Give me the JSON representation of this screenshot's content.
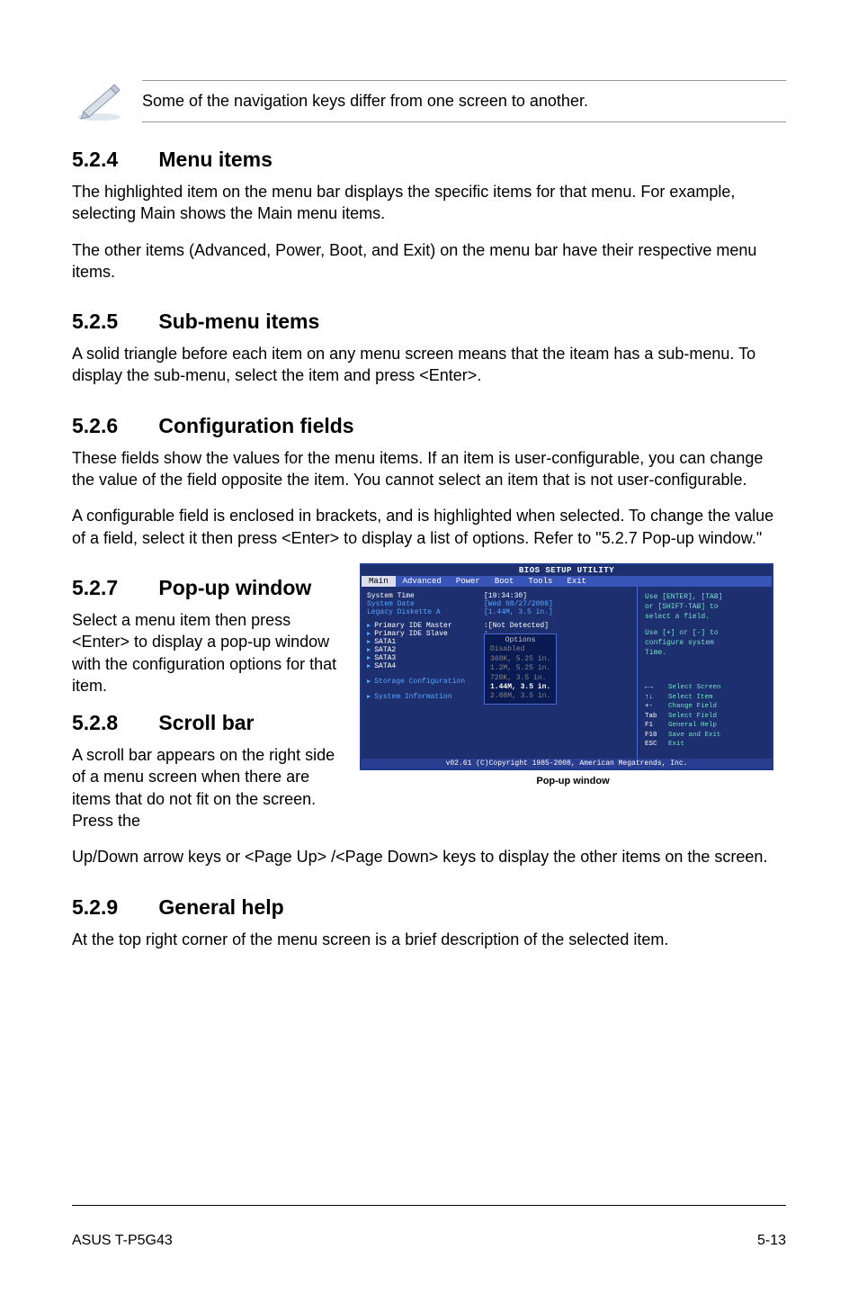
{
  "note": {
    "text": "Some of the navigation keys differ from one screen to another."
  },
  "s524": {
    "num": "5.2.4",
    "title": "Menu items",
    "p1": "The highlighted item on the menu bar  displays the specific items for that menu. For example, selecting Main shows the Main menu items.",
    "p2": "The other items (Advanced, Power, Boot, and Exit) on the menu bar have their respective menu items."
  },
  "s525": {
    "num": "5.2.5",
    "title": "Sub-menu items",
    "p1": "A solid triangle before each item on any menu screen means that the iteam has a sub-menu. To display the sub-menu, select the item and press <Enter>."
  },
  "s526": {
    "num": "5.2.6",
    "title": "Configuration fields",
    "p1": "These fields show the values for the menu items. If an item is user-configurable, you can change the value of the field opposite the item. You cannot select an item that is not user-configurable.",
    "p2": "A configurable field is enclosed in brackets, and is highlighted when selected. To change the value of a field, select it then press <Enter> to display a list of options. Refer to \"5.2.7 Pop-up window.\""
  },
  "s527": {
    "num": "5.2.7",
    "title": "Pop-up window",
    "p1": "Select a menu item then press <Enter> to display a pop-up window with the configuration options for that item."
  },
  "s528": {
    "num": "5.2.8",
    "title": "Scroll bar",
    "p1a": "A scroll bar appears on the right side of a menu screen when there are items that do not fit on the screen. Press the",
    "p1b": "Up/Down arrow keys or <Page Up> /<Page Down> keys to display the other items on the screen."
  },
  "s529": {
    "num": "5.2.9",
    "title": "General help",
    "p1": "At the top right corner of the menu screen is a brief description of the selected item."
  },
  "bios": {
    "title": "BIOS SETUP UTILITY",
    "menu": [
      "Main",
      "Advanced",
      "Power",
      "Boot",
      "Tools",
      "Exit"
    ],
    "rows": {
      "system_time_lbl": "System Time",
      "system_time_val": "[19:34:30]",
      "system_date_lbl": "System Date",
      "system_date_val": "[Wed 08/27/2008]",
      "legacy_lbl": "Legacy Diskette A",
      "legacy_val": "[1.44M, 3.5 in.]",
      "pri_master_lbl": "Primary IDE Master",
      "pri_master_val": ":[Not Detected]",
      "pri_slave_lbl": "Primary IDE Slave",
      "pri_slave_val": ":",
      "sata1_lbl": "SATA1",
      "sata1_val": ":",
      "sata2_lbl": "SATA2",
      "sata2_val": ":",
      "sata3_lbl": "SATA3",
      "sata3_val": ":",
      "sata4_lbl": "SATA4",
      "sata4_val": ":",
      "storage_lbl": "Storage Configuration",
      "sysinfo_lbl": "System Information"
    },
    "popup": {
      "header": "Options",
      "opt1": "Disabled",
      "opt2": "360K, 5.25 in.",
      "opt3": "1.2M, 5.25 in.",
      "opt4": "720K, 3.5 in.",
      "opt5": "1.44M, 3.5 in.",
      "opt6": "2.88M, 3.5 in."
    },
    "help": {
      "l1": "Use [ENTER], [TAB]",
      "l2": "or [SHIFT-TAB] to",
      "l3": "select a field.",
      "l4": "Use [+] or [-] to",
      "l5": "configure system",
      "l6": "Time."
    },
    "keys": {
      "k1s": "←→",
      "k1": "Select Screen",
      "k2s": "↑↓",
      "k2": "Select Item",
      "k3s": "+-",
      "k3": "Change Field",
      "k4s": "Tab",
      "k4": "Select Field",
      "k5s": "F1",
      "k5": "General Help",
      "k6s": "F10",
      "k6": "Save and Exit",
      "k7s": "ESC",
      "k7": "Exit"
    },
    "footer": "v02.61 (C)Copyright 1985-2008, American Megatrends, Inc.",
    "caption": "Pop-up window"
  },
  "footer": {
    "left": "ASUS T-P5G43",
    "right": "5-13"
  }
}
